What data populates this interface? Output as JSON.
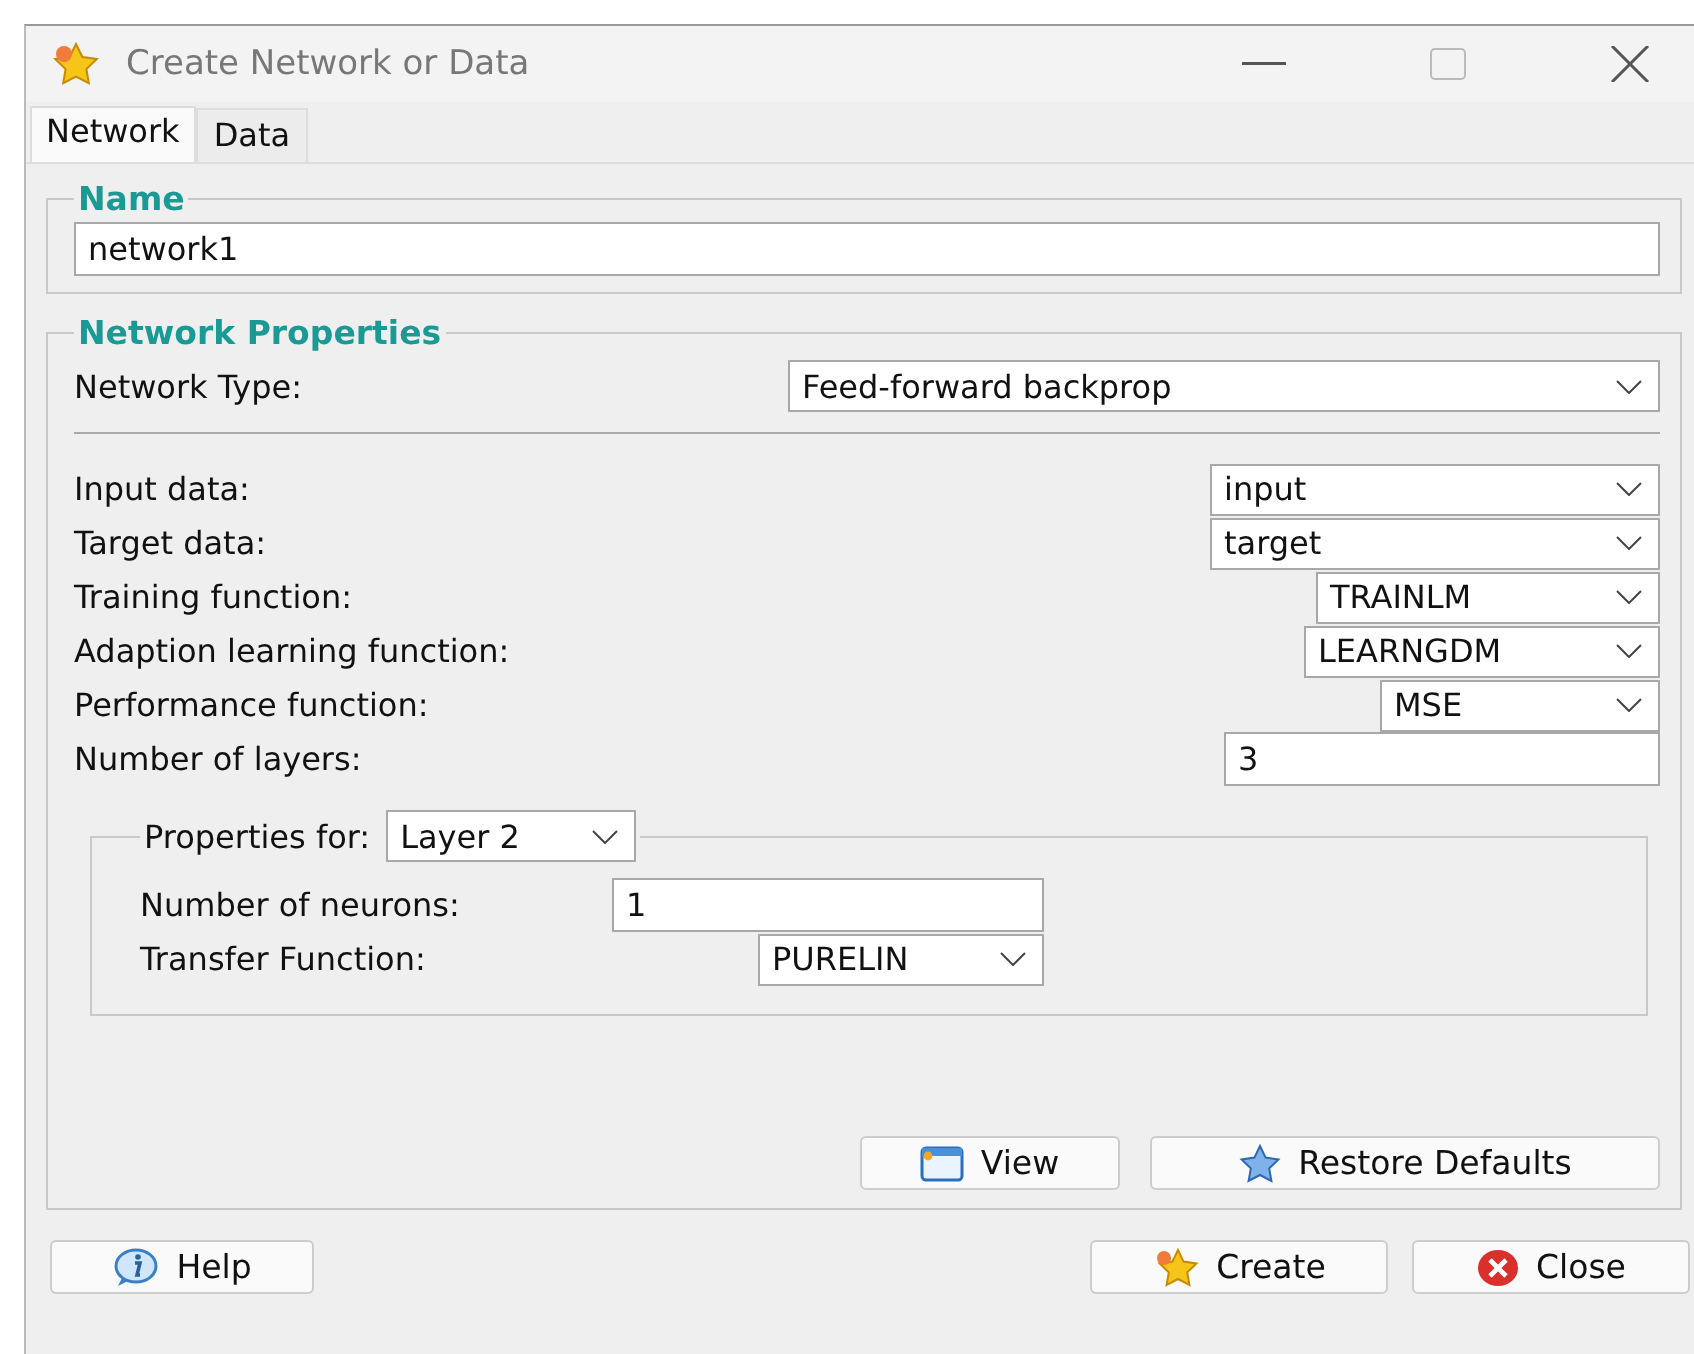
{
  "window": {
    "title": "Create Network or Data"
  },
  "tabs": [
    {
      "label": "Network",
      "selected": true
    },
    {
      "label": "Data",
      "selected": false
    }
  ],
  "name_group": {
    "legend": "Name",
    "value": "network1"
  },
  "properties_group": {
    "legend": "Network Properties",
    "network_type": {
      "label": "Network Type:",
      "value": "Feed-forward backprop"
    },
    "rows": [
      {
        "label": "Input data:",
        "kind": "dropdown",
        "value": "input"
      },
      {
        "label": "Target data:",
        "kind": "dropdown",
        "value": "target"
      },
      {
        "label": "Training function:",
        "kind": "dropdown",
        "value": "TRAINLM"
      },
      {
        "label": "Adaption learning function:",
        "kind": "dropdown",
        "value": "LEARNGDM"
      },
      {
        "label": "Performance function:",
        "kind": "dropdown",
        "value": "MSE"
      },
      {
        "label": "Number of layers:",
        "kind": "field",
        "value": "3"
      }
    ],
    "layer_group": {
      "label": "Properties for:",
      "value": "Layer 2",
      "rows": [
        {
          "label": "Number of neurons:",
          "kind": "field",
          "value": "1"
        },
        {
          "label": "Transfer Function:",
          "kind": "dropdown",
          "value": "PURELIN"
        }
      ]
    },
    "buttons": [
      {
        "label": "View",
        "kind": "view"
      },
      {
        "label": "Restore Defaults",
        "kind": "restore"
      }
    ]
  },
  "footer_buttons": [
    {
      "label": "Help",
      "kind": "help"
    },
    {
      "label": "Create",
      "kind": "create"
    },
    {
      "label": "Close",
      "kind": "close"
    }
  ]
}
